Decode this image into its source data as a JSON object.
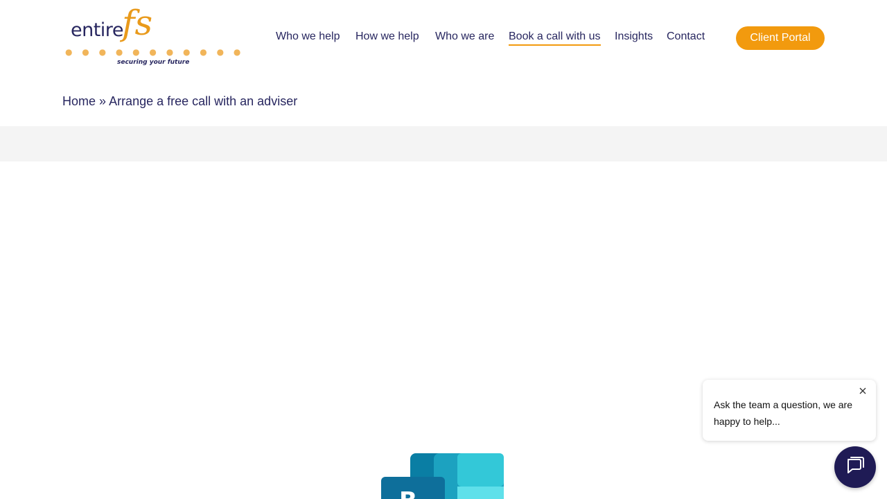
{
  "logo": {
    "word": "entire",
    "mark": "fs",
    "dots": "● ● ● ● ● ● ● ● ● ● ●",
    "tagline": "securing your future"
  },
  "nav": {
    "items": [
      {
        "label": "Who we help"
      },
      {
        "label": "How we help"
      },
      {
        "label": "Who we are"
      },
      {
        "label": "Book a call with us"
      },
      {
        "label": "Insights"
      },
      {
        "label": "Contact"
      }
    ],
    "active": "Book a call with us",
    "portal_label": "Client Portal"
  },
  "breadcrumb": {
    "home": "Home",
    "separator": "»",
    "current": "Arrange a free call with an adviser"
  },
  "chat": {
    "message": "Ask the team a question, we are happy to help...",
    "close_icon": "close-icon",
    "bubble_icon": "chat-icon"
  },
  "colors": {
    "brand_navy": "#27265f",
    "brand_orange": "#f29a0e",
    "chat_navy": "#1f1b55"
  }
}
